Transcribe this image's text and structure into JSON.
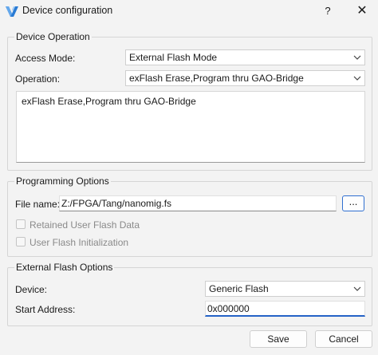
{
  "window": {
    "title": "Device configuration",
    "help_label": "?",
    "close_label": "✕"
  },
  "device_operation": {
    "group_title": "Device Operation",
    "access_mode_label": "Access Mode:",
    "access_mode_value": "External Flash Mode",
    "operation_label": "Operation:",
    "operation_value": "exFlash Erase,Program thru GAO-Bridge",
    "description": "exFlash Erase,Program thru GAO-Bridge"
  },
  "programming_options": {
    "group_title": "Programming Options",
    "file_name_label": "File name:",
    "file_name_value": "Z:/FPGA/Tang/nanomig.fs",
    "browse_label": "...",
    "retained_user_flash_label": "Retained User Flash Data",
    "user_flash_init_label": "User Flash Initialization"
  },
  "external_flash_options": {
    "group_title": "External Flash Options",
    "device_label": "Device:",
    "device_value": "Generic Flash",
    "start_address_label": "Start Address:",
    "start_address_value": "0x000000"
  },
  "buttons": {
    "save_label": "Save",
    "cancel_label": "Cancel"
  },
  "icons": {
    "app": "gowin-logo-icon",
    "help": "help-icon",
    "close": "close-icon",
    "dropdown": "chevron-down-icon"
  },
  "colors": {
    "accent": "#2563c7",
    "window_bg": "#f3f3f3"
  }
}
